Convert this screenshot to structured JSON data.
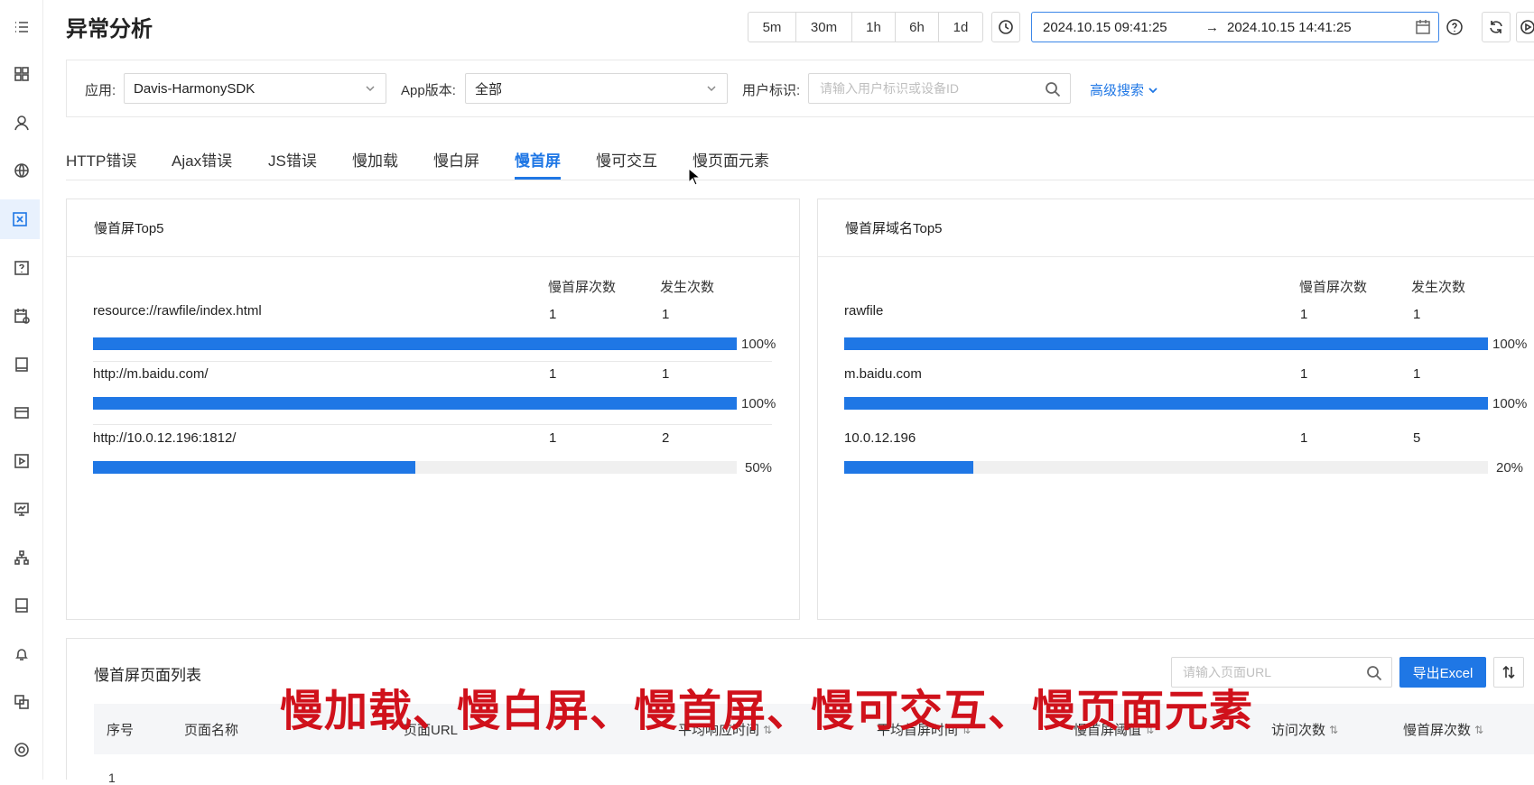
{
  "page": {
    "title": "异常分析"
  },
  "sidebar": {
    "icons": [
      "menu-icon",
      "dashboard-icon",
      "user-icon",
      "globe-icon",
      "error-icon",
      "question-icon",
      "calendar-icon",
      "book-icon",
      "card-icon",
      "play-icon",
      "monitor-icon",
      "topology-icon",
      "device-icon",
      "bell-icon",
      "layers-icon",
      "settings-icon"
    ]
  },
  "time_range": {
    "buttons": [
      "5m",
      "30m",
      "1h",
      "6h",
      "1d"
    ],
    "start": "2024.10.15 09:41:25",
    "arrow": "→",
    "end": "2024.10.15 14:41:25"
  },
  "filters": {
    "app_label": "应用:",
    "app_value": "Davis-HarmonySDK",
    "version_label": "App版本:",
    "version_value": "全部",
    "user_label": "用户标识:",
    "user_placeholder": "请输入用户标识或设备ID",
    "advanced": "高级搜索"
  },
  "tabs": [
    {
      "label": "HTTP错误"
    },
    {
      "label": "Ajax错误"
    },
    {
      "label": "JS错误"
    },
    {
      "label": "慢加载"
    },
    {
      "label": "慢白屏"
    },
    {
      "label": "慢首屏",
      "active": true
    },
    {
      "label": "慢可交互"
    },
    {
      "label": "慢页面元素"
    }
  ],
  "panel_left": {
    "title": "慢首屏Top5",
    "col1": "慢首屏次数",
    "col2": "发生次数",
    "rows": [
      {
        "name": "resource://rawfile/index.html",
        "slow": "1",
        "count": "1",
        "pct_label": "100%",
        "pct": 100
      },
      {
        "name": "http://m.baidu.com/",
        "slow": "1",
        "count": "1",
        "pct_label": "100%",
        "pct": 100
      },
      {
        "name": "http://10.0.12.196:1812/",
        "slow": "1",
        "count": "2",
        "pct_label": "50%",
        "pct": 50
      }
    ]
  },
  "panel_right": {
    "title": "慢首屏域名Top5",
    "col1": "慢首屏次数",
    "col2": "发生次数",
    "rows": [
      {
        "name": "rawfile",
        "slow": "1",
        "count": "1",
        "pct_label": "100%",
        "pct": 100
      },
      {
        "name": "m.baidu.com",
        "slow": "1",
        "count": "1",
        "pct_label": "100%",
        "pct": 100
      },
      {
        "name": "10.0.12.196",
        "slow": "1",
        "count": "5",
        "pct_label": "20%",
        "pct": 20
      }
    ]
  },
  "list": {
    "title": "慢首屏页面列表",
    "search_placeholder": "请输入页面URL",
    "export_label": "导出Excel",
    "columns": [
      "序号",
      "页面名称",
      "页面URL",
      "平均响应时间",
      "平均首屏时间",
      "慢首屏阈值",
      "访问次数",
      "慢首屏次数"
    ],
    "sort_glyph": "⇅",
    "first_row_index": "1"
  },
  "overlay_caption": "慢加载、慢白屏、慢首屏、慢可交互、慢页面元素"
}
